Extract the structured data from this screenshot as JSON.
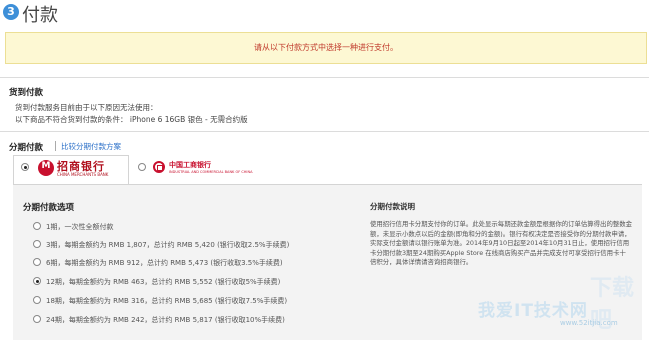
{
  "header": {
    "step": "3",
    "title": "付款"
  },
  "notice": "请从以下付款方式中选择一种进行支付。",
  "cod": {
    "title": "货到付款",
    "line1": "货到付款服务目前由于以下原因无法使用：",
    "line2": "以下商品不符合货到付款的条件： iPhone 6 16GB 银色 - 无需合约版"
  },
  "installment": {
    "title": "分期付款",
    "compare_link": "比较分期付款方案",
    "banks": [
      {
        "name_cn": "招商银行",
        "name_en": "CHINA MERCHANTS BANK",
        "selected": true
      },
      {
        "name_cn": "中国工商银行",
        "name_en": "INDUSTRIAL AND COMMERCIAL BANK OF CHINA",
        "selected": false
      }
    ],
    "options_title": "分期付款选项",
    "options": [
      {
        "label": "1期，一次性全额付款",
        "selected": false
      },
      {
        "label": "3期，每期金额约为 RMB 1,807，总计约 RMB 5,420 (银行收取2.5%手续费)",
        "selected": false
      },
      {
        "label": "6期，每期金额约为 RMB 912，总计约 RMB 5,473 (银行收取3.5%手续费)",
        "selected": false
      },
      {
        "label": "12期，每期金额约为 RMB 463，总计约 RMB 5,552 (银行收取5%手续费)",
        "selected": true
      },
      {
        "label": "18期，每期金额约为 RMB 316，总计约 RMB 5,685 (银行收取7.5%手续费)",
        "selected": false
      },
      {
        "label": "24期，每期金额约为 RMB 242，总计约 RMB 5,817 (银行收取10%手续费)",
        "selected": false
      }
    ],
    "desc_title": "分期付款说明",
    "desc_text": "使用招行信用卡分期支付你的订单。此处显示每期还款金额是根据你的订单估算得出的整数金额，未显示小数点以后的金额(即角和分的金额)。银行有权决定是否接受你的分期付款申请，实际支付金额请以银行账单为准。2014年9月10日起至2014年10月31日止，使用招行信用卡分期付款3期至24期购买Apple Store 在线商店购买产品并完成支付可享受招行信用卡十倍积分，具体详情请咨询招商银行。"
  },
  "watermark": {
    "text": "我爱IT技术网",
    "url": "www.52itjia.com",
    "big": "下载吧"
  },
  "colors": {
    "accent": "#3d8fd8",
    "notice_bg": "#fdf8d3",
    "notice_text": "#c0392b",
    "link": "#2a6fc8",
    "bank_red": "#c8102e"
  }
}
